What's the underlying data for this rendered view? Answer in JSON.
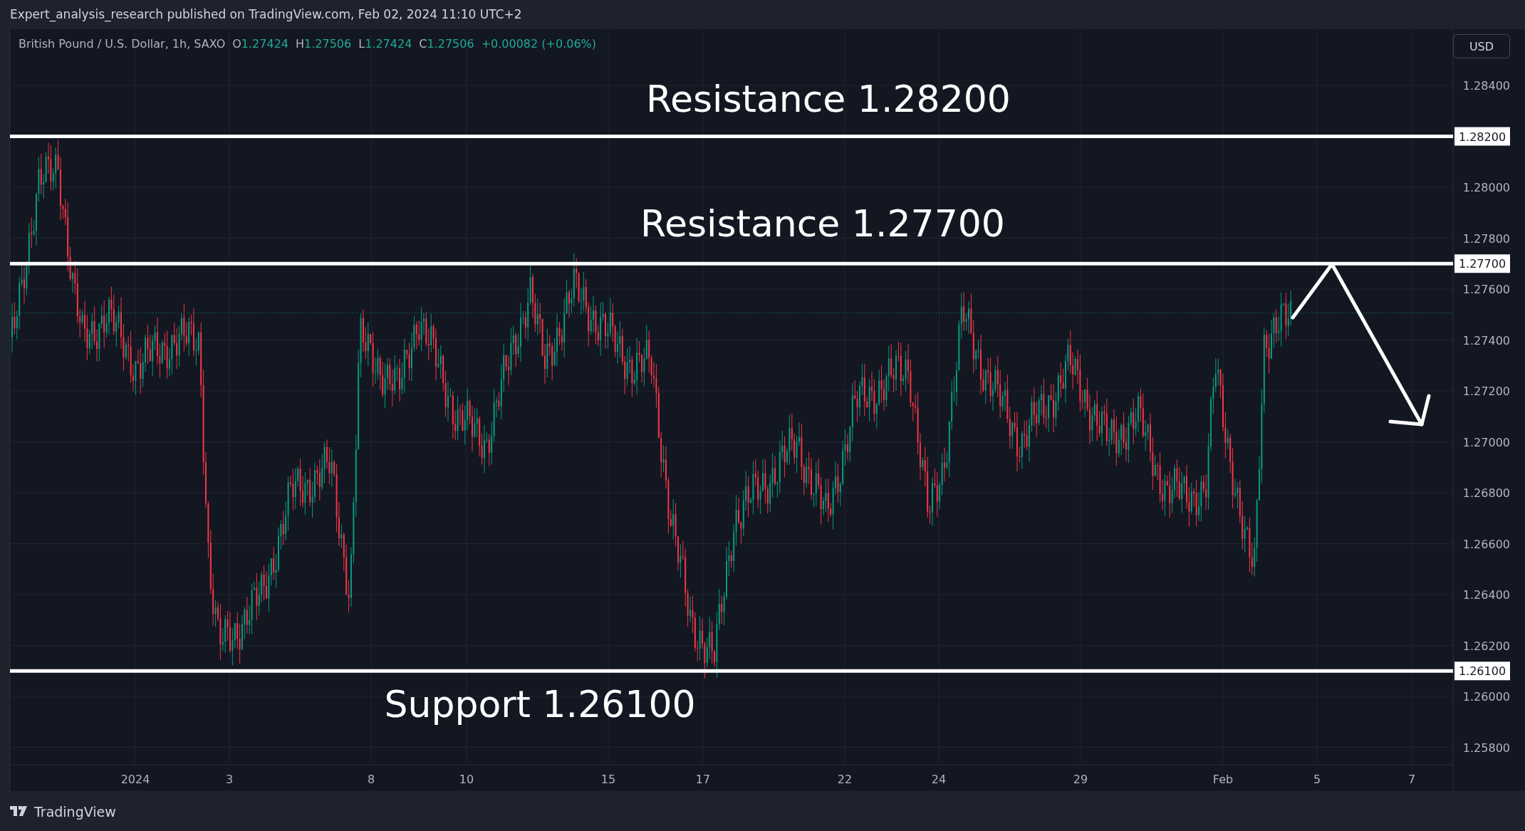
{
  "header": {
    "title": "Expert_analysis_research published on TradingView.com, Feb 02, 2024 11:10 UTC+2"
  },
  "legend": {
    "symbol": "British Pound / U.S. Dollar, 1h, SAXO",
    "ohlc": [
      {
        "key": "O",
        "value": "1.27424"
      },
      {
        "key": "H",
        "value": "1.27506"
      },
      {
        "key": "L",
        "value": "1.27424"
      },
      {
        "key": "C",
        "value": "1.27506"
      }
    ],
    "change": "+0.00082 (+0.06%)"
  },
  "currency_button": "USD",
  "price_axis": {
    "labels": [
      "1.28400",
      "1.28000",
      "1.27800",
      "1.27600",
      "1.27400",
      "1.27200",
      "1.27000",
      "1.26800",
      "1.26600",
      "1.26400",
      "1.26200",
      "1.26000",
      "1.25800"
    ]
  },
  "levels": [
    {
      "label": "Resistance 1.28200",
      "price_tag": "1.28200"
    },
    {
      "label": "Resistance 1.27700",
      "price_tag": "1.27700"
    },
    {
      "label": "Support 1.26100",
      "price_tag": "1.26100"
    }
  ],
  "time_axis": {
    "labels": [
      "2024",
      "3",
      "8",
      "10",
      "15",
      "17",
      "22",
      "24",
      "29",
      "Feb",
      "5",
      "7"
    ]
  },
  "footer": {
    "brand": "TradingView"
  }
}
